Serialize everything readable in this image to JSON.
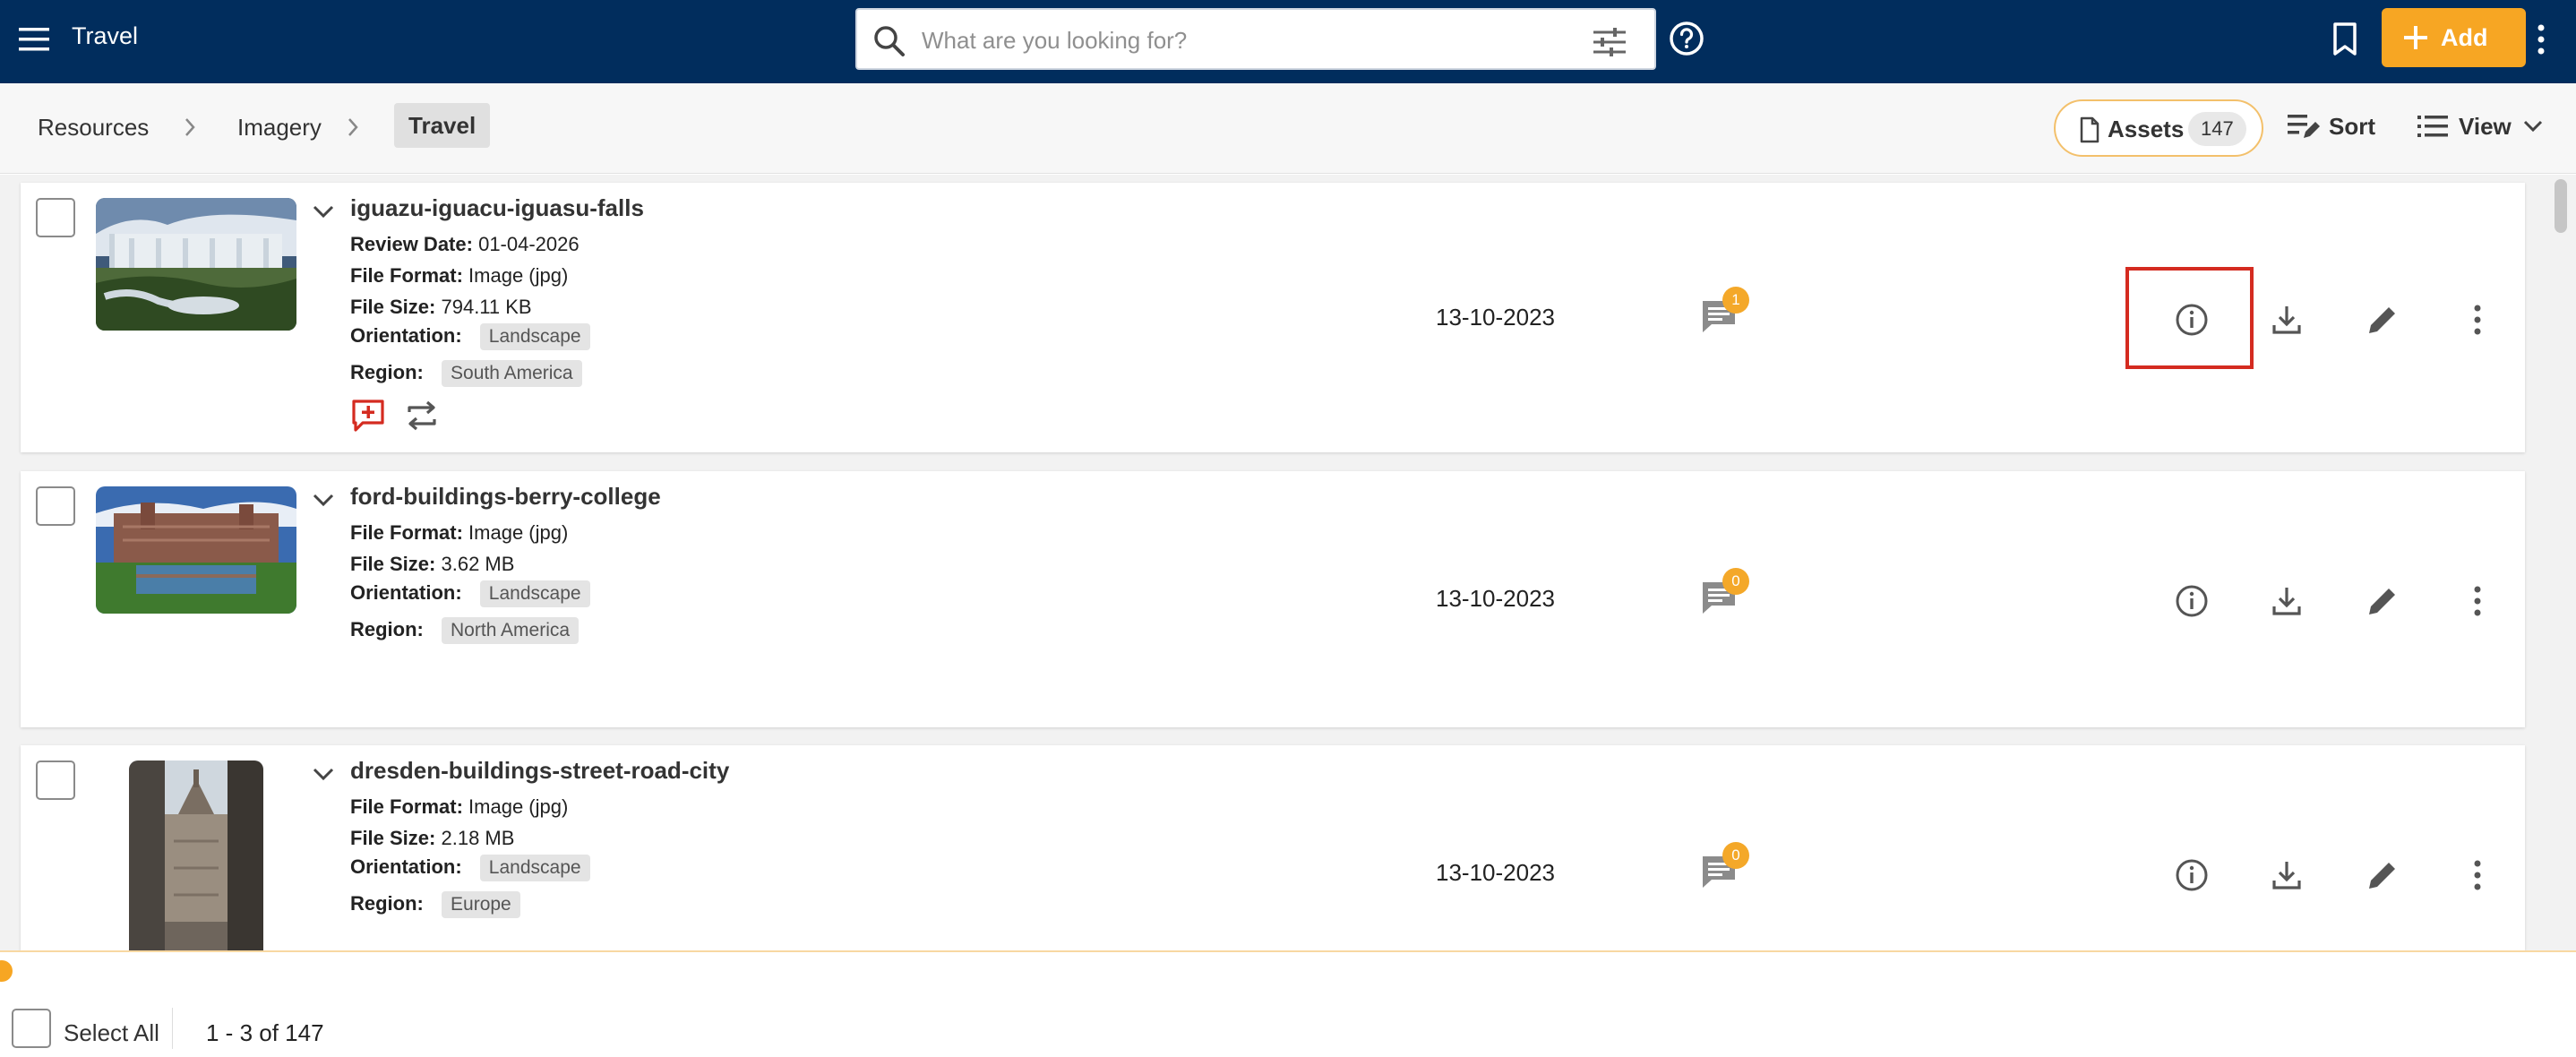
{
  "header": {
    "app_title": "Travel",
    "search_placeholder": "What are you looking for?",
    "add_label": "Add",
    "brand_color": "#012d5d",
    "accent_color": "#f7a623"
  },
  "breadcrumb": {
    "items": [
      "Resources",
      "Imagery"
    ],
    "current": "Travel"
  },
  "toolbar": {
    "assets_label": "Assets",
    "assets_count": "147",
    "sort_label": "Sort",
    "view_label": "View"
  },
  "assets": [
    {
      "name": "iguazu-iguacu-iguasu-falls",
      "review_date_label": "Review Date:",
      "review_date": "01-04-2026",
      "format_label": "File Format:",
      "format": "Image (jpg)",
      "size_label": "File Size:",
      "size": "794.11 KB",
      "orientation_label": "Orientation:",
      "orientation": "Landscape",
      "region_label": "Region:",
      "region": "South America",
      "date": "13-10-2023",
      "comments": "1"
    },
    {
      "name": "ford-buildings-berry-college",
      "format_label": "File Format:",
      "format": "Image (jpg)",
      "size_label": "File Size:",
      "size": "3.62 MB",
      "orientation_label": "Orientation:",
      "orientation": "Landscape",
      "region_label": "Region:",
      "region": "North America",
      "date": "13-10-2023",
      "comments": "0"
    },
    {
      "name": "dresden-buildings-street-road-city",
      "format_label": "File Format:",
      "format": "Image (jpg)",
      "size_label": "File Size:",
      "size": "2.18 MB",
      "orientation_label": "Orientation:",
      "orientation": "Landscape",
      "region_label": "Region:",
      "region": "Europe",
      "date": "13-10-2023",
      "comments": "0"
    }
  ],
  "footer": {
    "select_all_label": "Select All",
    "pagination": "1 - 3 of 147"
  }
}
